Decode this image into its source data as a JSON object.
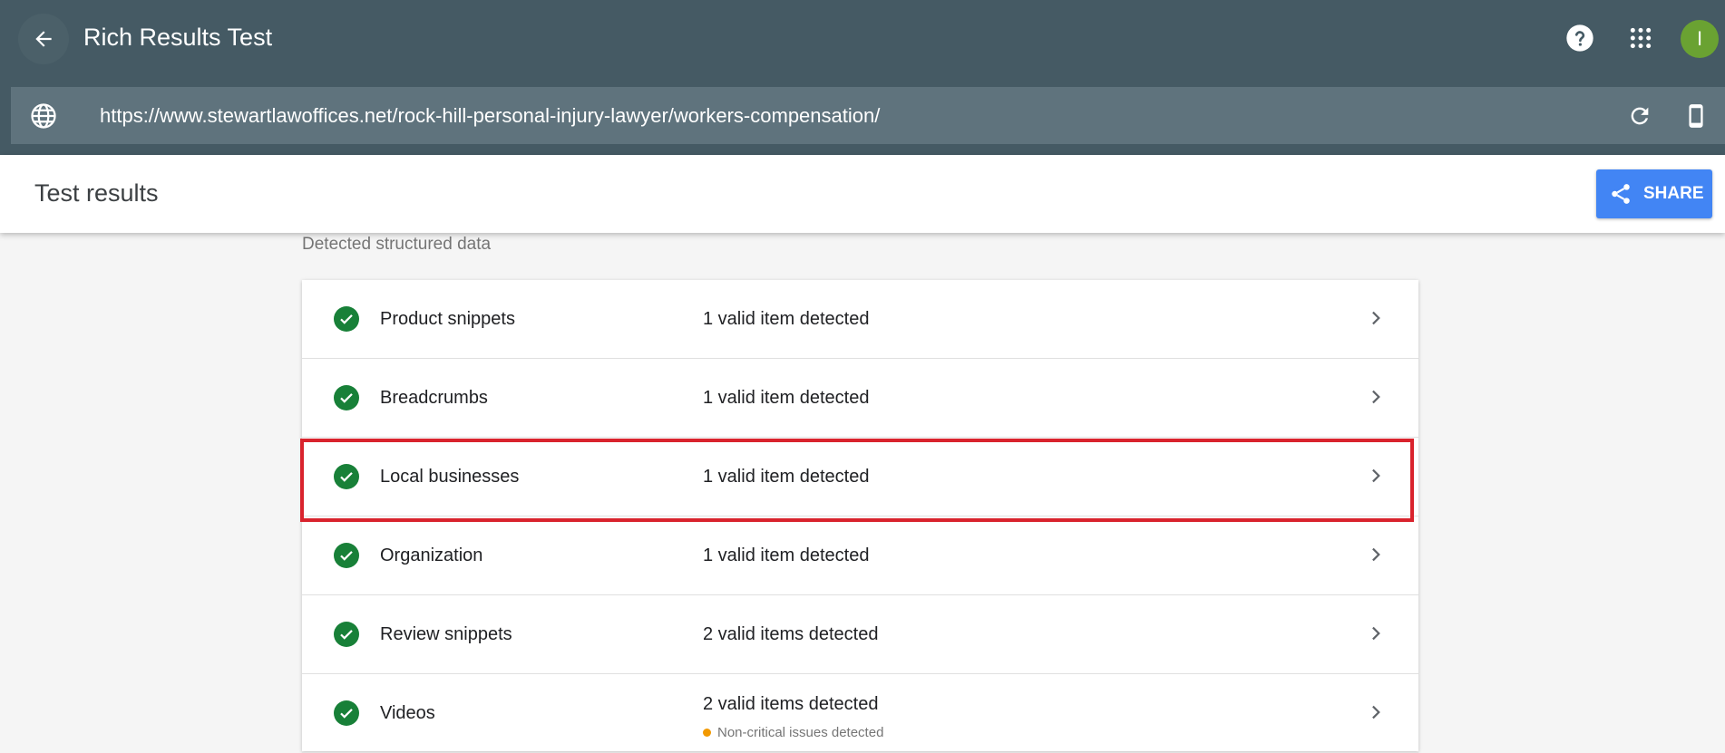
{
  "app": {
    "title": "Rich Results Test",
    "avatar_initial": "I",
    "accent_color": "#455a64"
  },
  "urlbar": {
    "url": "https://www.stewartlawoffices.net/rock-hill-personal-injury-lawyer/workers-compensation/"
  },
  "results": {
    "title": "Test results",
    "share_label": "SHARE",
    "section_label": "Detected structured data",
    "items": [
      {
        "name": "Product snippets",
        "status": "1 valid item detected"
      },
      {
        "name": "Breadcrumbs",
        "status": "1 valid item detected"
      },
      {
        "name": "Local businesses",
        "status": "1 valid item detected"
      },
      {
        "name": "Organization",
        "status": "1 valid item detected"
      },
      {
        "name": "Review snippets",
        "status": "2 valid items detected"
      },
      {
        "name": "Videos",
        "status": "2 valid items detected",
        "note": "Non-critical issues detected"
      }
    ]
  }
}
